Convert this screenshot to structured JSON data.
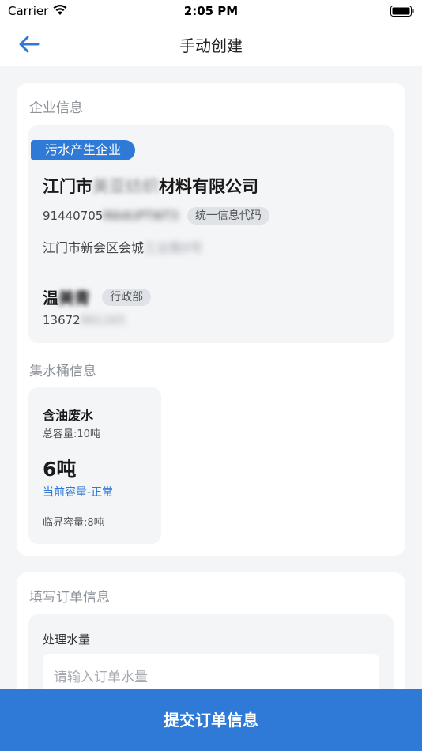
{
  "status_bar": {
    "carrier": "Carrier",
    "time": "2:05 PM"
  },
  "nav": {
    "title": "手动创建",
    "back_icon": "arrow-left-icon"
  },
  "colors": {
    "accent": "#2e7ad6",
    "page_bg": "#f4f5f7",
    "muted_text": "#8e939a"
  },
  "company_section": {
    "label": "企业信息",
    "type_badge": "污水产生企业",
    "name_prefix": "江门市",
    "name_redacted": "美亚纺织",
    "name_suffix": "材料有限公司",
    "credit_code_prefix": "91440705",
    "credit_code_redacted": "MA4UPTWT3",
    "credit_code_tag": "统一信息代码",
    "address_prefix": "江门市新会区会城",
    "address_redacted": "工业路9号",
    "contact_name_prefix": "温",
    "contact_name_redacted": "美青",
    "contact_dept": "行政部",
    "phone_prefix": "13672",
    "phone_redacted": "881265"
  },
  "bucket_section": {
    "label": "集水桶信息",
    "bucket": {
      "title": "含油废水",
      "total_capacity": "总容量:10吨",
      "current_amount": "6吨",
      "current_status": "当前容量-正常",
      "critical_capacity": "临界容量:8吨"
    }
  },
  "order_section": {
    "label": "填写订单信息",
    "water_label": "处理水量",
    "water_placeholder": "请输入订单水量",
    "water_value": ""
  },
  "submit": {
    "label": "提交订单信息"
  }
}
